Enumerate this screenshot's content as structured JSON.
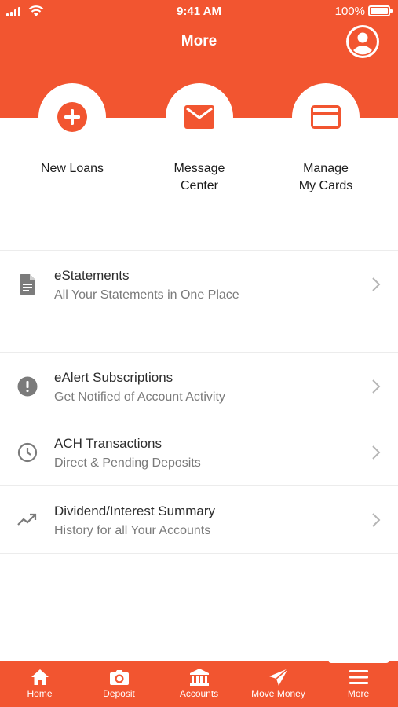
{
  "status_bar": {
    "time": "9:41 AM",
    "battery": "100%"
  },
  "header": {
    "title": "More"
  },
  "quick_actions": [
    {
      "label": "New Loans",
      "icon": "plus-circle-icon"
    },
    {
      "label": "Message\nCenter",
      "icon": "envelope-icon"
    },
    {
      "label": "Manage\nMy Cards",
      "icon": "credit-card-icon"
    }
  ],
  "list": [
    {
      "title": "eStatements",
      "subtitle": "All Your Statements in One Place",
      "icon": "document-icon"
    },
    {
      "title": "eAlert Subscriptions",
      "subtitle": "Get Notified of Account Activity",
      "icon": "alert-icon"
    },
    {
      "title": "ACH Transactions",
      "subtitle": "Direct & Pending Deposits",
      "icon": "clock-icon"
    },
    {
      "title": "Dividend/Interest Summary",
      "subtitle": "History for all Your Accounts",
      "icon": "trending-up-icon"
    }
  ],
  "tabs": [
    {
      "label": "Home",
      "icon": "home-icon"
    },
    {
      "label": "Deposit",
      "icon": "camera-icon"
    },
    {
      "label": "Accounts",
      "icon": "bank-icon"
    },
    {
      "label": "Move Money",
      "icon": "send-icon"
    },
    {
      "label": "More",
      "icon": "menu-icon"
    }
  ],
  "colors": {
    "brand": "#f25530",
    "icon_gray": "#7b7b7b"
  }
}
